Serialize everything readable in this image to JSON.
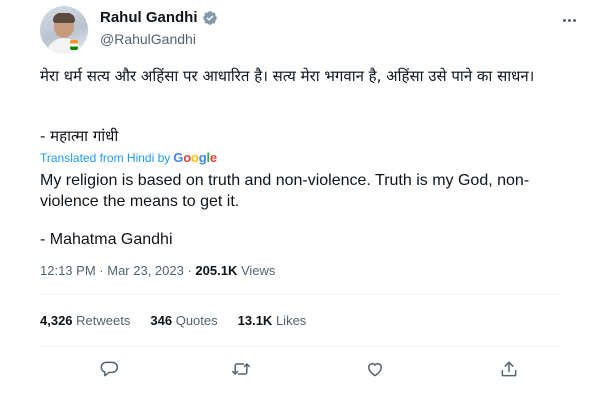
{
  "author": {
    "display_name": "Rahul Gandhi",
    "handle": "@RahulGandhi"
  },
  "tweet": {
    "hindi_line1": "मेरा धर्म सत्य और अहिंसा पर आधारित है। सत्य मेरा भगवान है, अहिंसा उसे पाने का साधन।",
    "hindi_line2": "- महात्मा गांधी",
    "translated_prefix": "Translated from Hindi by",
    "translation_provider": "Google",
    "english_line1": "My religion is based on truth and non-violence. Truth is my God, non-violence the means to get it.",
    "english_line2": "- Mahatma Gandhi"
  },
  "meta": {
    "time": "12:13 PM",
    "date": "Mar 23, 2023",
    "views_count": "205.1K",
    "views_label": "Views"
  },
  "stats": {
    "retweets_count": "4,326",
    "retweets_label": "Retweets",
    "quotes_count": "346",
    "quotes_label": "Quotes",
    "likes_count": "13.1K",
    "likes_label": "Likes"
  },
  "colors": {
    "accent": "#1d9bf0",
    "text": "#0f1419",
    "secondary": "#536471",
    "icon": "#536471"
  }
}
